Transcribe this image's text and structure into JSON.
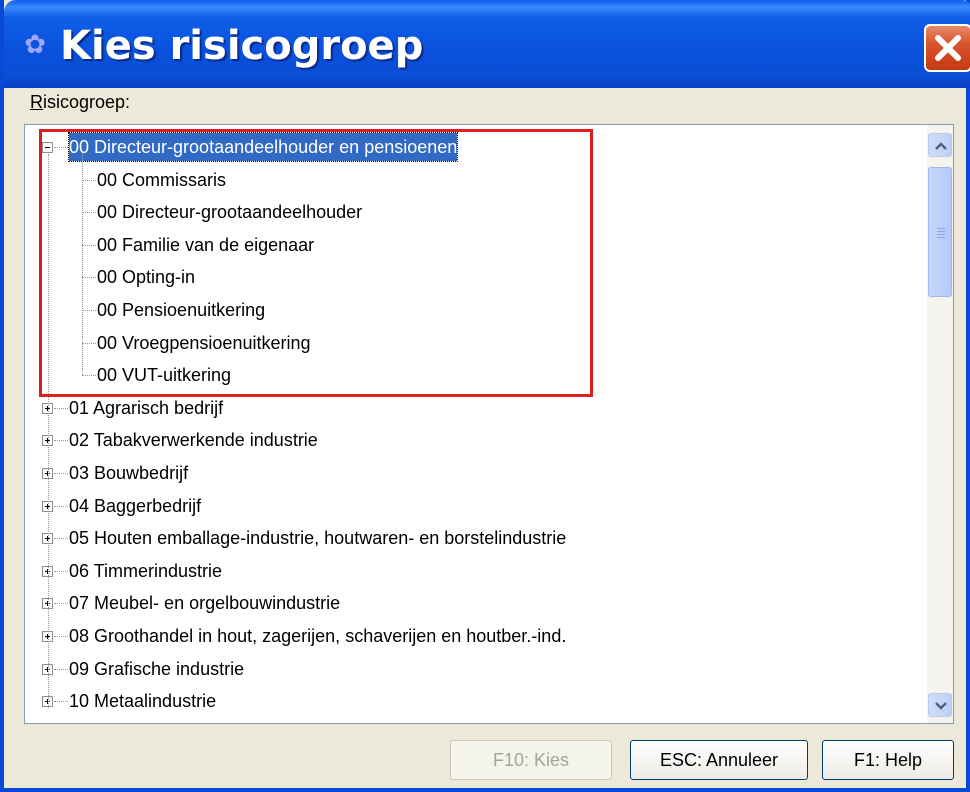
{
  "window": {
    "title": "Kies risicogroep"
  },
  "label": {
    "prefix": "R",
    "rest": "isicogroep:"
  },
  "tree": {
    "items": [
      {
        "text": "00 Directeur-grootaandeelhouder en pensioenen",
        "level": 0,
        "state": "expanded",
        "selected": true
      },
      {
        "text": "00 Commissaris",
        "level": 1
      },
      {
        "text": "00 Directeur-grootaandeelhouder",
        "level": 1
      },
      {
        "text": "00 Familie van de eigenaar",
        "level": 1
      },
      {
        "text": "00 Opting-in",
        "level": 1
      },
      {
        "text": "00 Pensioenuitkering",
        "level": 1
      },
      {
        "text": "00 Vroegpensioenuitkering",
        "level": 1
      },
      {
        "text": "00 VUT-uitkering",
        "level": 1
      },
      {
        "text": "01 Agrarisch bedrijf",
        "level": 0,
        "state": "collapsed"
      },
      {
        "text": "02 Tabakverwerkende industrie",
        "level": 0,
        "state": "collapsed"
      },
      {
        "text": "03 Bouwbedrijf",
        "level": 0,
        "state": "collapsed"
      },
      {
        "text": "04 Baggerbedrijf",
        "level": 0,
        "state": "collapsed"
      },
      {
        "text": "05 Houten emballage-industrie, houtwaren- en borstelindustrie",
        "level": 0,
        "state": "collapsed"
      },
      {
        "text": "06 Timmerindustrie",
        "level": 0,
        "state": "collapsed"
      },
      {
        "text": "07 Meubel- en orgelbouwindustrie",
        "level": 0,
        "state": "collapsed"
      },
      {
        "text": "08 Groothandel in hout, zagerijen, schaverijen en houtber.-ind.",
        "level": 0,
        "state": "collapsed"
      },
      {
        "text": "09 Grafische industrie",
        "level": 0,
        "state": "collapsed"
      },
      {
        "text": "10 Metaalindustrie",
        "level": 0,
        "state": "collapsed"
      }
    ]
  },
  "buttons": {
    "kies": "F10: Kies",
    "annuleer": "ESC: Annuleer",
    "help": "F1: Help"
  },
  "colors": {
    "titlebar": "#0a50dc",
    "selection": "#316ac5",
    "highlight": "#e21d1d"
  },
  "icons": {
    "app": "app-icon",
    "close": "close-icon",
    "scroll_up": "chevron-up-icon",
    "scroll_down": "chevron-down-icon"
  }
}
